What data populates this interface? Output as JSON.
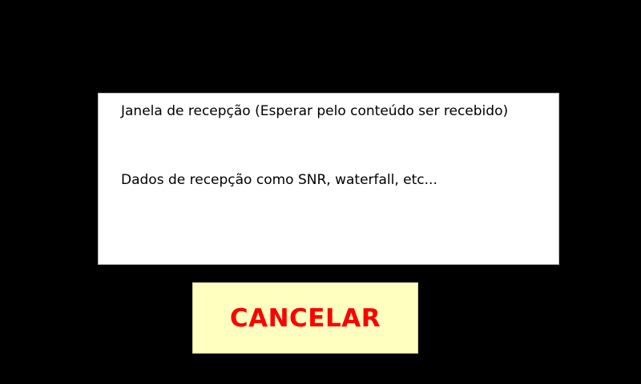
{
  "reception_panel": {
    "window_text": "Janela de recepção (Esperar pelo conteúdo ser recebido)",
    "data_text": "Dados de recepção como SNR, waterfall, etc..."
  },
  "cancel_button": {
    "label": "CANCELAR",
    "text_color": "#ff0000",
    "background_color": "#ffffc0"
  },
  "colors": {
    "background": "#000000",
    "panel": "#ffffff"
  }
}
